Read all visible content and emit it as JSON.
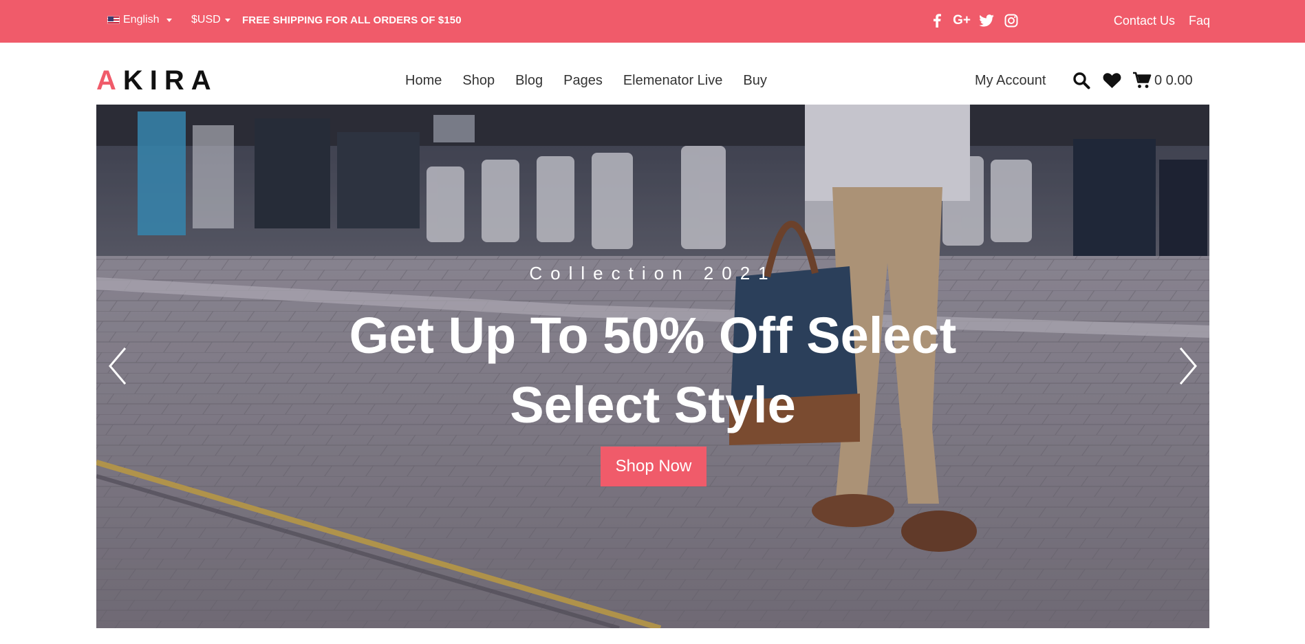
{
  "topbar": {
    "language": "English",
    "currency": "$USD",
    "shipping_notice": "FREE SHIPPING FOR ALL ORDERS OF $150",
    "social": [
      "facebook-icon",
      "google-plus-icon",
      "twitter-icon",
      "instagram-icon"
    ],
    "google_plus_label": "G+",
    "contact_label": "Contact Us",
    "faq_label": "Faq"
  },
  "header": {
    "logo_first": "A",
    "logo_rest": "KIRA",
    "nav": [
      "Home",
      "Shop",
      "Blog",
      "Pages",
      "Elemenator Live",
      "Buy"
    ],
    "account_label": "My Account",
    "cart_text": "0 0.00"
  },
  "hero": {
    "subtitle": "Collection 2021",
    "headline_line1": "Get Up To 50% Off Select",
    "headline_line2": "Select Style",
    "button_label": "Shop Now"
  },
  "colors": {
    "accent": "#f05b6a",
    "text_dark": "#222222"
  }
}
